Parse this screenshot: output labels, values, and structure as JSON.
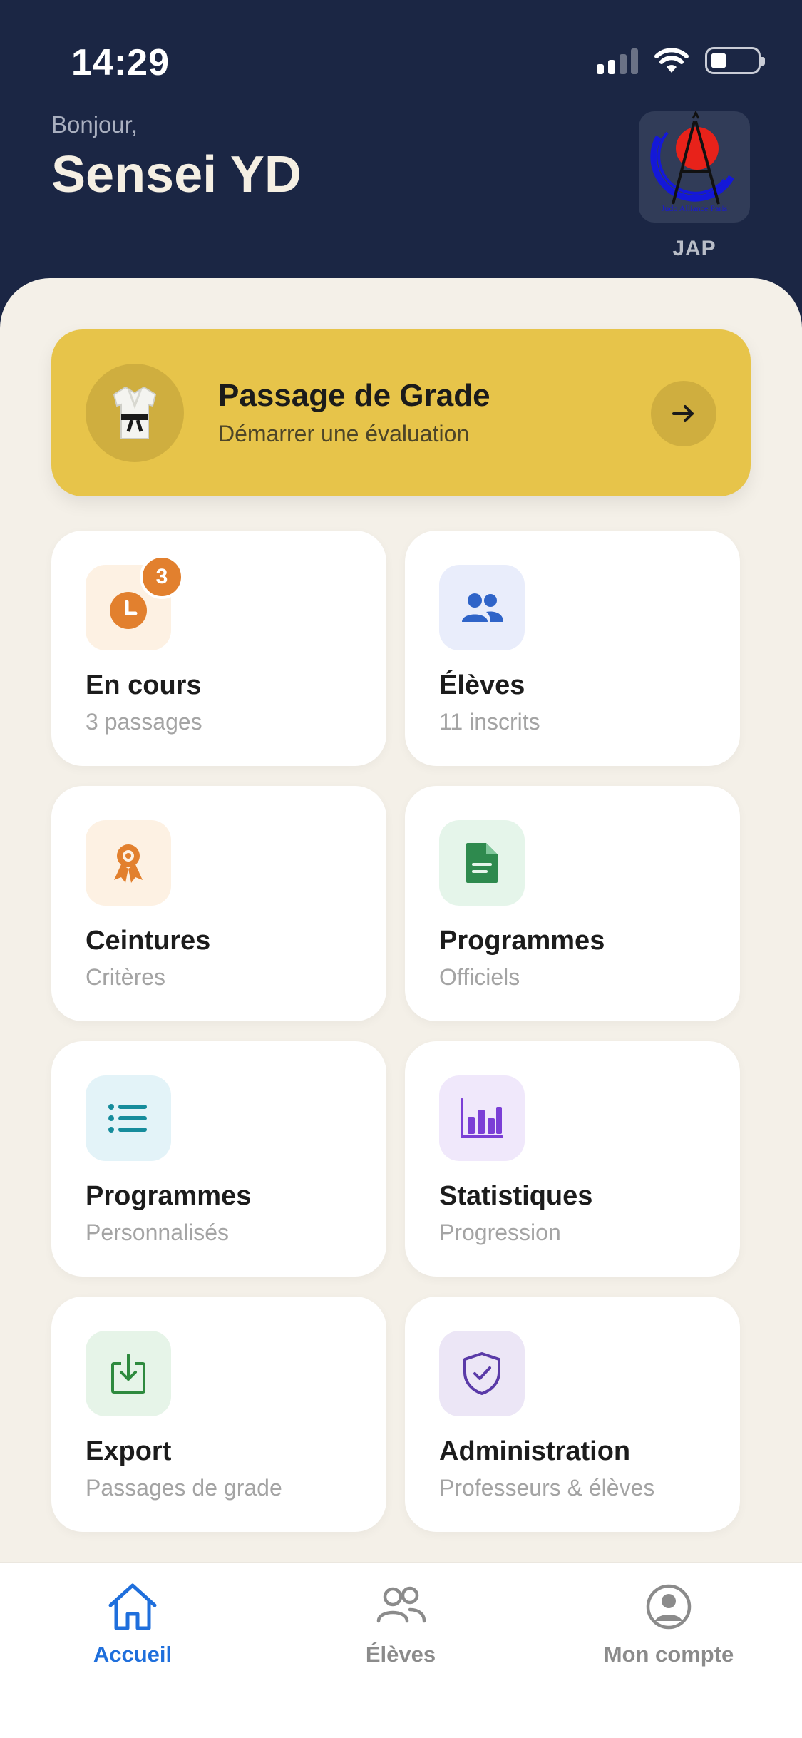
{
  "status_bar": {
    "time": "14:29"
  },
  "header": {
    "greeting": "Bonjour,",
    "user_name": "Sensei YD",
    "club_logo_text": "Judo Alliance Paris",
    "club_label": "JAP"
  },
  "cta": {
    "title": "Passage de Grade",
    "subtitle": "Démarrer une évaluation",
    "icon": "judogi-icon",
    "color": "#e7c44a"
  },
  "cards": [
    {
      "title": "En cours",
      "subtitle": "3 passages",
      "icon": "clock-icon",
      "badge": "3"
    },
    {
      "title": "Élèves",
      "subtitle": "11 inscrits",
      "icon": "users-icon"
    },
    {
      "title": "Ceintures",
      "subtitle": "Critères",
      "icon": "award-icon"
    },
    {
      "title": "Programmes",
      "subtitle": "Officiels",
      "icon": "document-icon"
    },
    {
      "title": "Programmes",
      "subtitle": "Personnalisés",
      "icon": "list-icon"
    },
    {
      "title": "Statistiques",
      "subtitle": "Progression",
      "icon": "bar-chart-icon"
    },
    {
      "title": "Export",
      "subtitle": "Passages de grade",
      "icon": "download-icon"
    },
    {
      "title": "Administration",
      "subtitle": "Professeurs & élèves",
      "icon": "shield-check-icon"
    }
  ],
  "tabbar": {
    "items": [
      {
        "label": "Accueil",
        "icon": "home-icon",
        "active": true
      },
      {
        "label": "Élèves",
        "icon": "users-outline-icon",
        "active": false
      },
      {
        "label": "Mon compte",
        "icon": "account-icon",
        "active": false
      }
    ],
    "active_color": "#1f6fdc"
  }
}
